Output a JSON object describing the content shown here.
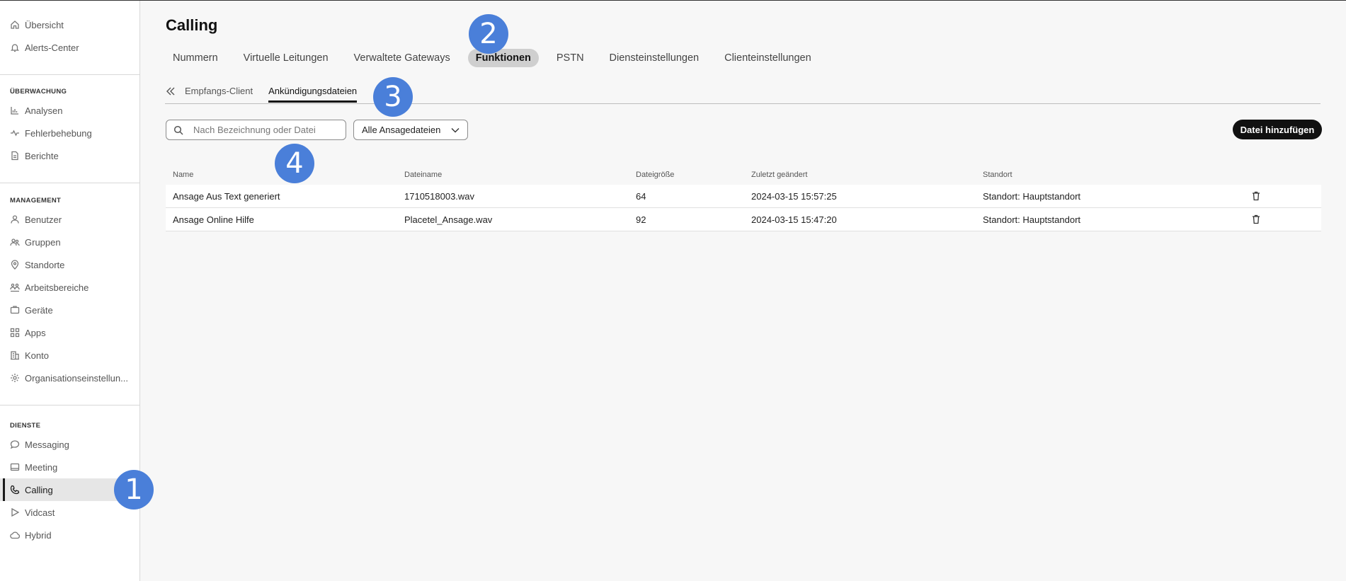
{
  "sidebar": {
    "top_items": [
      {
        "label": "Übersicht",
        "icon": "home-icon"
      },
      {
        "label": "Alerts-Center",
        "icon": "bell-icon"
      }
    ],
    "sections": [
      {
        "heading": "ÜBERWACHUNG",
        "items": [
          {
            "label": "Analysen",
            "icon": "chart-icon"
          },
          {
            "label": "Fehlerbehebung",
            "icon": "pulse-icon"
          },
          {
            "label": "Berichte",
            "icon": "document-icon"
          }
        ]
      },
      {
        "heading": "MANAGEMENT",
        "items": [
          {
            "label": "Benutzer",
            "icon": "user-icon"
          },
          {
            "label": "Gruppen",
            "icon": "group-icon"
          },
          {
            "label": "Standorte",
            "icon": "location-icon"
          },
          {
            "label": "Arbeitsbereiche",
            "icon": "workspace-icon"
          },
          {
            "label": "Geräte",
            "icon": "device-icon"
          },
          {
            "label": "Apps",
            "icon": "apps-icon"
          },
          {
            "label": "Konto",
            "icon": "building-icon"
          },
          {
            "label": "Organisationseinstellun...",
            "icon": "gear-icon"
          }
        ]
      },
      {
        "heading": "DIENSTE",
        "items": [
          {
            "label": "Messaging",
            "icon": "chat-icon"
          },
          {
            "label": "Meeting",
            "icon": "meeting-icon"
          },
          {
            "label": "Calling",
            "icon": "phone-icon",
            "active": true
          },
          {
            "label": "Vidcast",
            "icon": "play-icon"
          },
          {
            "label": "Hybrid",
            "icon": "cloud-icon"
          }
        ]
      }
    ]
  },
  "page": {
    "title": "Calling"
  },
  "tabs": [
    "Nummern",
    "Virtuelle Leitungen",
    "Verwaltete Gateways",
    "Funktionen",
    "PSTN",
    "Diensteinstellungen",
    "Clienteinstellungen"
  ],
  "active_tab": "Funktionen",
  "subtabs": [
    "Empfangs-Client",
    "Ankündigungsdateien"
  ],
  "active_subtab": "Ankündigungsdateien",
  "toolbar": {
    "search_placeholder": "Nach Bezeichnung oder Datei",
    "filter_label": "Alle Ansagedateien",
    "add_label": "Datei hinzufügen"
  },
  "table": {
    "columns": [
      "Name",
      "Dateiname",
      "Dateigröße",
      "Zuletzt geändert",
      "Standort"
    ],
    "rows": [
      [
        "Ansage Aus Text generiert",
        "1710518003.wav",
        "64",
        "2024-03-15 15:57:25",
        "Standort: Hauptstandort"
      ],
      [
        "Ansage Online Hilfe",
        "Placetel_Ansage.wav",
        "92",
        "2024-03-15 15:47:20",
        "Standort: Hauptstandort"
      ]
    ]
  },
  "markers": [
    "1",
    "2",
    "3",
    "4"
  ],
  "colors": {
    "accent": "#4a7fd9",
    "primary_button": "#111111",
    "active_tab_bg": "#cfcfcf"
  }
}
